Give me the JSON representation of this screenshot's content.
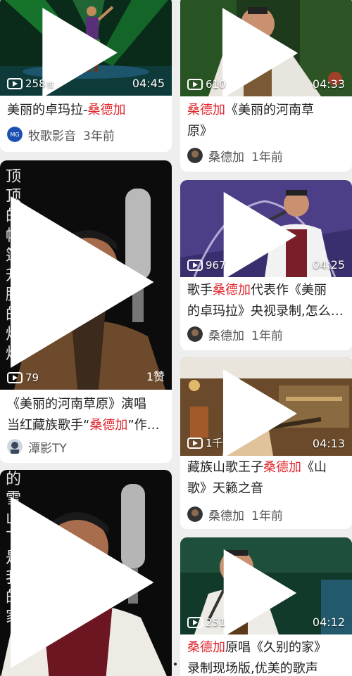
{
  "cards": [
    {
      "stat": "258",
      "stat_suffix": "拉",
      "duration": "04:45",
      "title_parts": [
        "美丽的卓玛拉-",
        "桑德加"
      ],
      "author": "牧歌影音",
      "ago": "3年前",
      "avatar_text": "MG"
    },
    {
      "stat": "610",
      "duration": "04:33",
      "title_line1": [
        "桑德加",
        "《美丽的河南草"
      ],
      "title_line2": "原》",
      "author": "桑德加",
      "ago": "1年前"
    },
    {
      "stat": "79",
      "likes": "1赞",
      "vertical_text": "顶顶的帐篷升腾的炊烟",
      "title_line1": "《美丽的河南草原》演唱",
      "title_line2": [
        "当红藏族歌手“",
        "桑德加",
        "”作…"
      ],
      "author": "潭影TY"
    },
    {
      "stat": "967",
      "duration": "04:25",
      "title_line1": [
        "歌手",
        "桑德加",
        "代表作《美丽"
      ],
      "title_line2": "的卓玛拉》央视录制,怎么…",
      "author": "桑德加",
      "ago": "1年前"
    },
    {
      "vertical_text": "的雪山下是我的家"
    },
    {
      "stat": "1千",
      "duration": "04:13",
      "title_line1": [
        "藏族山歌王子",
        "桑德加",
        "《山"
      ],
      "title_line2": "歌》天籁之音",
      "author": "桑德加",
      "ago": "1年前"
    },
    {
      "stat": "251",
      "duration": "04:12",
      "title_line1": [
        "桑德加",
        "原唱《久别的家》"
      ],
      "title_line2": "录制现场版,优美的歌声"
    }
  ],
  "colors": {
    "highlight": "#e0262d",
    "background": "#eeeeee"
  }
}
